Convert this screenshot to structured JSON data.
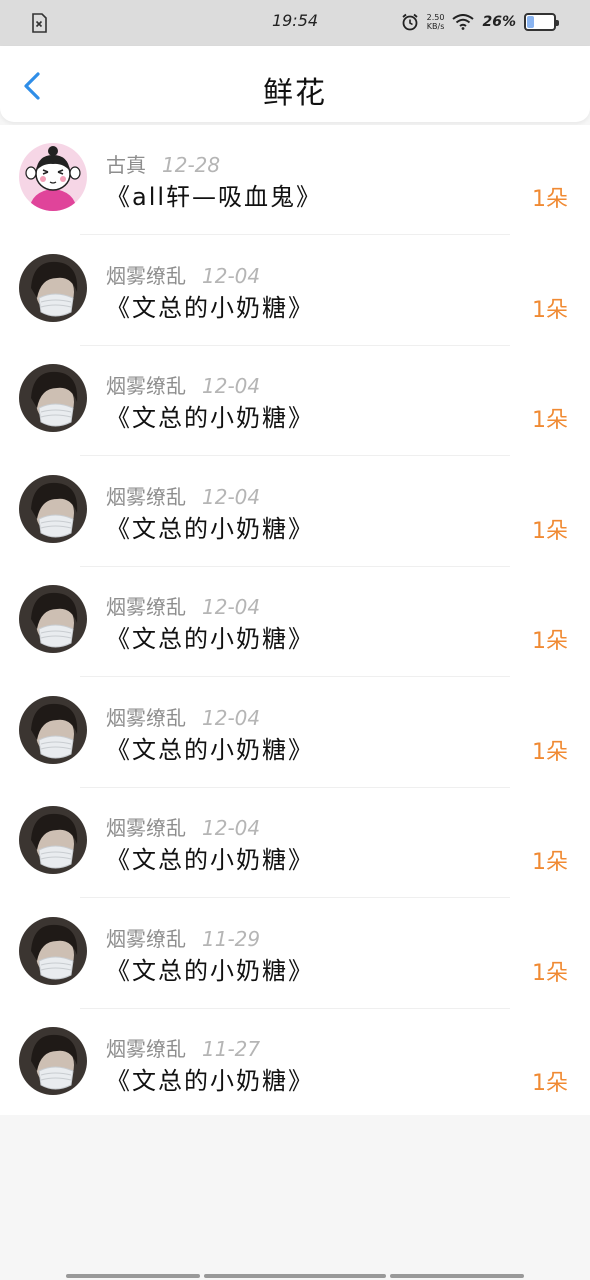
{
  "status_bar": {
    "time": "19:54",
    "net_speed": "2.50",
    "net_unit": "KB/s",
    "battery": "26%",
    "battery_level": 0.26
  },
  "header": {
    "title": "鲜花"
  },
  "colors": {
    "accent_blue": "#2f8ee8",
    "count_orange": "#f08a33"
  },
  "items": [
    {
      "user": "古真",
      "date": "12-28",
      "book": "《all轩—吸血鬼》",
      "count": "1朵",
      "avatar_icon": "cartoon-girl-avatar"
    },
    {
      "user": "烟雾缭乱",
      "date": "12-04",
      "book": "《文总的小奶糖》",
      "count": "1朵",
      "avatar_icon": "masked-person-avatar"
    },
    {
      "user": "烟雾缭乱",
      "date": "12-04",
      "book": "《文总的小奶糖》",
      "count": "1朵",
      "avatar_icon": "masked-person-avatar"
    },
    {
      "user": "烟雾缭乱",
      "date": "12-04",
      "book": "《文总的小奶糖》",
      "count": "1朵",
      "avatar_icon": "masked-person-avatar"
    },
    {
      "user": "烟雾缭乱",
      "date": "12-04",
      "book": "《文总的小奶糖》",
      "count": "1朵",
      "avatar_icon": "masked-person-avatar"
    },
    {
      "user": "烟雾缭乱",
      "date": "12-04",
      "book": "《文总的小奶糖》",
      "count": "1朵",
      "avatar_icon": "masked-person-avatar"
    },
    {
      "user": "烟雾缭乱",
      "date": "12-04",
      "book": "《文总的小奶糖》",
      "count": "1朵",
      "avatar_icon": "masked-person-avatar"
    },
    {
      "user": "烟雾缭乱",
      "date": "11-29",
      "book": "《文总的小奶糖》",
      "count": "1朵",
      "avatar_icon": "masked-person-avatar"
    },
    {
      "user": "烟雾缭乱",
      "date": "11-27",
      "book": "《文总的小奶糖》",
      "count": "1朵",
      "avatar_icon": "masked-person-avatar"
    }
  ]
}
